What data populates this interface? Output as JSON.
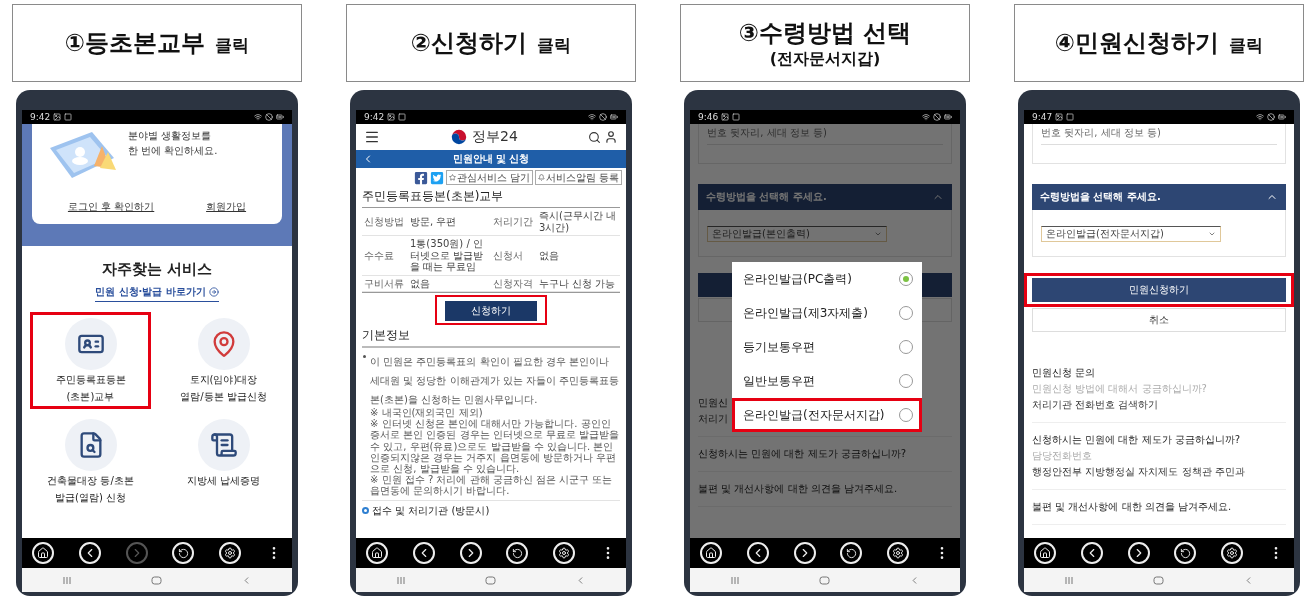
{
  "steps": [
    {
      "header": {
        "title": "①등초본교부",
        "action": "클릭"
      },
      "phone": {
        "kind": "home",
        "time": "9:42",
        "forward_disabled": true,
        "banner": {
          "lines": [
            "분야별 생활정보를",
            "한 번에 확인하세요."
          ],
          "links": [
            "로그인 후 확인하기",
            "회원가입"
          ]
        },
        "section_title": "자주찾는 서비스",
        "shortcut": "민원 신청·발급 바로가기",
        "services": [
          {
            "kind": "id_card",
            "lines": [
              "주민등록표등본",
              "(초본)교부"
            ],
            "highlighted": true
          },
          {
            "kind": "land",
            "lines": [
              "토지(임야)대장",
              "열람/등본 발급신청"
            ],
            "highlighted": false
          },
          {
            "kind": "building",
            "lines": [
              "건축물대장 등/초본",
              "발급(열람) 신청"
            ],
            "highlighted": false
          },
          {
            "kind": "tax",
            "lines": [
              "지방세 납세증명"
            ],
            "highlighted": false
          }
        ]
      }
    },
    {
      "header": {
        "title": "②신청하기",
        "action": "클릭"
      },
      "phone": {
        "kind": "detail",
        "time": "9:42",
        "forward_disabled": false,
        "logo": "정부24",
        "nav_title": "민원안내 및 신청",
        "share_buttons": [
          "관심서비스 담기",
          "서비스알림 등록"
        ],
        "title": "주민등록표등본(초본)교부",
        "table": [
          [
            "신청방법",
            "방문, 우편",
            "처리기간",
            "즉시(근무시간 내 3시간)"
          ],
          [
            "수수료",
            "1통(350원) / 인터넷으로 발급받을 때는 무료임",
            "신청서",
            "없음"
          ],
          [
            "구비서류",
            "없음",
            "신청자격",
            "누구나 신청 가능"
          ]
        ],
        "apply_button": {
          "label": "신청하기",
          "highlighted": true
        },
        "info_title": "기본정보",
        "info": [
          {
            "kind": "bullet",
            "text": "이 민원은 주민등록표의 확인이 필요한 경우 본인이나 세대원 및 정당한 이해관계가 있는 자들이 주민등록표등본(초본)을 신청하는 민원사무입니다."
          },
          {
            "kind": "note",
            "text": "※ 내국인(재외국민 제외)"
          },
          {
            "kind": "note",
            "text": "※ 인터넷 신청은 본인에 대해서만 가능합니다. 공인인증서로 본인 인증된 경우는 인터넷으로 무료로 발급받을 수 있고, 우편(유료)으로도 발급받을 수 있습니다. 본인 인증되지않은 경우는 거주지 읍면동에 방문하거나 우편으로 신청, 발급받을 수 있습니다."
          },
          {
            "kind": "note",
            "text": "※ 민원 접수 ? 처리에 관해 궁금하신 점은 시군구 또는 읍면동에 문의하시기 바랍니다."
          }
        ],
        "section_link": "접수 및 처리기관 (방문시)"
      }
    },
    {
      "header": {
        "title": "③수령방법 선택",
        "subtitle": "(전자문서지갑)"
      },
      "phone": {
        "kind": "method_popup",
        "time": "9:46",
        "forward_disabled": false,
        "top_text": "번호 뒷자리, 세대 정보 등)",
        "method_title": "수령방법을 선택해 주세요.",
        "select_value": "온라인발급(본인출력)",
        "faq": [
          {
            "title": "민원신",
            "lines": [
              "처리기"
            ]
          },
          {
            "title": "신청하시는 민원에 대한 제도가 궁금하십니까?"
          },
          {
            "title": "불편 및 개선사항에 대한 의견을 남겨주세요."
          }
        ],
        "options": [
          {
            "label": "온라인발급(PC출력)",
            "selected": true,
            "highlighted": false
          },
          {
            "label": "온라인발급(제3자제출)",
            "selected": false,
            "highlighted": false
          },
          {
            "label": "등기보통우편",
            "selected": false,
            "highlighted": false
          },
          {
            "label": "일반보통우편",
            "selected": false,
            "highlighted": false
          },
          {
            "label": "온라인발급(전자문서지갑)",
            "selected": false,
            "highlighted": true
          }
        ]
      }
    },
    {
      "header": {
        "title": "④민원신청하기",
        "action": "클릭"
      },
      "phone": {
        "kind": "method_form",
        "time": "9:47",
        "forward_disabled": false,
        "top_text": "번호 뒷자리, 세대 정보 등)",
        "method_title": "수령방법을 선택해 주세요.",
        "select_value": "온라인발급(전자문서지갑)",
        "submit": {
          "label": "민원신청하기",
          "highlighted": true
        },
        "cancel": "취소",
        "faq": [
          {
            "title": "민원신청 문의",
            "lines": [
              "민원신청 방법에 대해서 궁금하십니까?",
              "처리기관 전화번호 검색하기"
            ]
          },
          {
            "title": "신청하시는 민원에 대한 제도가 궁금하십니까?",
            "lines": [
              "담당전화번호",
              "행정안전부 지방행정실 자치제도 정책관 주민과"
            ]
          },
          {
            "title": "불편 및 개선사항에 대한 의견을 남겨주세요."
          }
        ]
      }
    }
  ]
}
